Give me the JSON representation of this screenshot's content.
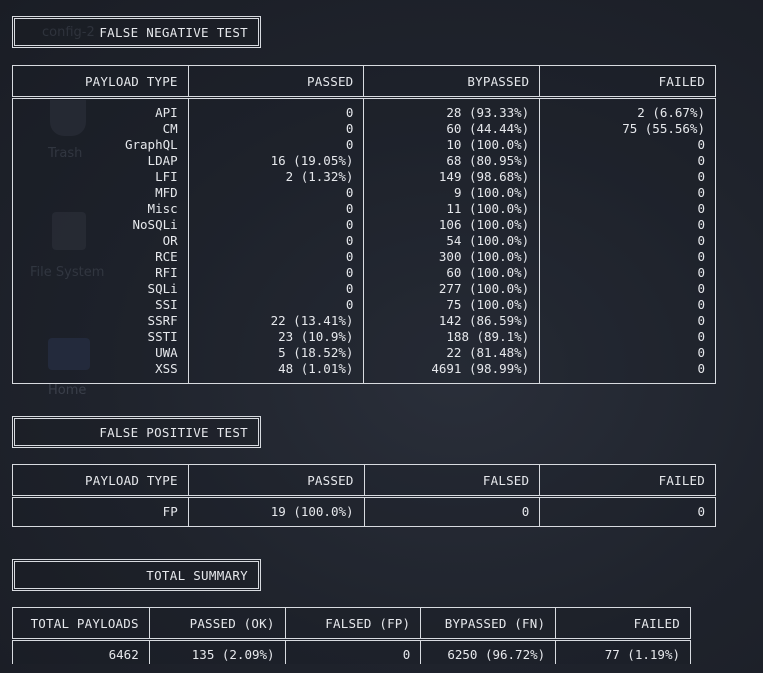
{
  "desktop": {
    "labels": [
      "config-2",
      "Trash",
      "File System",
      "Home"
    ]
  },
  "fn_test": {
    "title": "FALSE NEGATIVE TEST",
    "headers": [
      "PAYLOAD TYPE",
      "PASSED",
      "BYPASSED",
      "FAILED"
    ],
    "rows": [
      [
        "API",
        "0",
        "28 (93.33%)",
        "2 (6.67%)"
      ],
      [
        "CM",
        "0",
        "60 (44.44%)",
        "75 (55.56%)"
      ],
      [
        "GraphQL",
        "0",
        "10 (100.0%)",
        "0"
      ],
      [
        "LDAP",
        "16 (19.05%)",
        "68 (80.95%)",
        "0"
      ],
      [
        "LFI",
        "2 (1.32%)",
        "149 (98.68%)",
        "0"
      ],
      [
        "MFD",
        "0",
        "9 (100.0%)",
        "0"
      ],
      [
        "Misc",
        "0",
        "11 (100.0%)",
        "0"
      ],
      [
        "NoSQLi",
        "0",
        "106 (100.0%)",
        "0"
      ],
      [
        "OR",
        "0",
        "54 (100.0%)",
        "0"
      ],
      [
        "RCE",
        "0",
        "300 (100.0%)",
        "0"
      ],
      [
        "RFI",
        "0",
        "60 (100.0%)",
        "0"
      ],
      [
        "SQLi",
        "0",
        "277 (100.0%)",
        "0"
      ],
      [
        "SSI",
        "0",
        "75 (100.0%)",
        "0"
      ],
      [
        "SSRF",
        "22 (13.41%)",
        "142 (86.59%)",
        "0"
      ],
      [
        "SSTI",
        "23 (10.9%)",
        "188 (89.1%)",
        "0"
      ],
      [
        "UWA",
        "5 (18.52%)",
        "22 (81.48%)",
        "0"
      ],
      [
        "XSS",
        "48 (1.01%)",
        "4691 (98.99%)",
        "0"
      ]
    ]
  },
  "fp_test": {
    "title": "FALSE POSITIVE TEST",
    "headers": [
      "PAYLOAD TYPE",
      "PASSED",
      "FALSED",
      "FAILED"
    ],
    "rows": [
      [
        "FP",
        "19 (100.0%)",
        "0",
        "0"
      ]
    ]
  },
  "summary": {
    "title": "TOTAL SUMMARY",
    "headers": [
      "TOTAL PAYLOADS",
      "PASSED (OK)",
      "FALSED (FP)",
      "BYPASSED (FN)",
      "FAILED"
    ],
    "rows": [
      [
        "6462",
        "135 (2.09%)",
        "0",
        "6250 (96.72%)",
        "77 (1.19%)"
      ]
    ]
  }
}
